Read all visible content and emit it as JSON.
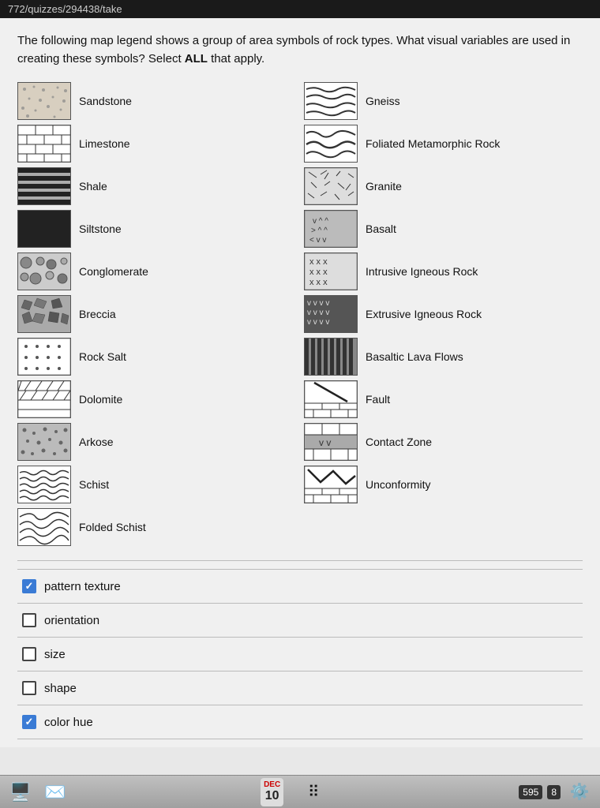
{
  "titleBar": {
    "url": "772/quizzes/294438/take"
  },
  "question": {
    "text": "The following map legend shows a group of area symbols of rock types. What visual variables are used in creating these symbols? Select ",
    "boldText": "ALL",
    "textEnd": " that apply."
  },
  "legend": {
    "items": [
      {
        "id": "sandstone",
        "label": "Sandstone",
        "pattern": "sandstone",
        "col": 0
      },
      {
        "id": "gneiss",
        "label": "Gneiss",
        "pattern": "gneiss",
        "col": 1
      },
      {
        "id": "limestone",
        "label": "Limestone",
        "pattern": "limestone",
        "col": 0
      },
      {
        "id": "foliated",
        "label": "Foliated Metamorphic Rock",
        "pattern": "foliated",
        "col": 1
      },
      {
        "id": "shale",
        "label": "Shale",
        "pattern": "shale",
        "col": 0
      },
      {
        "id": "granite",
        "label": "Granite",
        "pattern": "granite",
        "col": 1
      },
      {
        "id": "siltstone",
        "label": "Siltstone",
        "pattern": "siltstone",
        "col": 0
      },
      {
        "id": "basalt",
        "label": "Basalt",
        "pattern": "basalt",
        "col": 1
      },
      {
        "id": "conglomerate",
        "label": "Conglomerate",
        "pattern": "conglomerate",
        "col": 0
      },
      {
        "id": "intrusive",
        "label": "Intrusive Igneous Rock",
        "pattern": "intrusive",
        "col": 1
      },
      {
        "id": "breccia",
        "label": "Breccia",
        "pattern": "breccia",
        "col": 0
      },
      {
        "id": "extrusive",
        "label": "Extrusive Igneous Rock",
        "pattern": "extrusive",
        "col": 1
      },
      {
        "id": "rock-salt",
        "label": "Rock Salt",
        "pattern": "rock-salt",
        "col": 0
      },
      {
        "id": "basaltic-lava",
        "label": "Basaltic Lava Flows",
        "pattern": "basaltic-lava",
        "col": 1
      },
      {
        "id": "dolomite",
        "label": "Dolomite",
        "pattern": "dolomite",
        "col": 0
      },
      {
        "id": "fault",
        "label": "Fault",
        "pattern": "fault",
        "col": 1
      },
      {
        "id": "arkose",
        "label": "Arkose",
        "pattern": "arkose",
        "col": 0
      },
      {
        "id": "contact-zone",
        "label": "Contact Zone",
        "pattern": "contact-zone",
        "col": 1
      },
      {
        "id": "schist",
        "label": "Schist",
        "pattern": "schist",
        "col": 0
      },
      {
        "id": "unconformity",
        "label": "Unconformity",
        "pattern": "unconformity",
        "col": 1
      },
      {
        "id": "folded-schist",
        "label": "Folded Schist",
        "pattern": "folded-schist",
        "col": 0
      }
    ]
  },
  "answers": [
    {
      "id": "pattern-texture",
      "label": "pattern texture",
      "checked": true
    },
    {
      "id": "orientation",
      "label": "orientation",
      "checked": false
    },
    {
      "id": "size",
      "label": "size",
      "checked": false
    },
    {
      "id": "shape",
      "label": "shape",
      "checked": false
    },
    {
      "id": "color-hue",
      "label": "color hue",
      "checked": true
    }
  ],
  "taskbar": {
    "decLabel": "DEC",
    "decDate": "10",
    "badge": "595",
    "num": "8"
  }
}
